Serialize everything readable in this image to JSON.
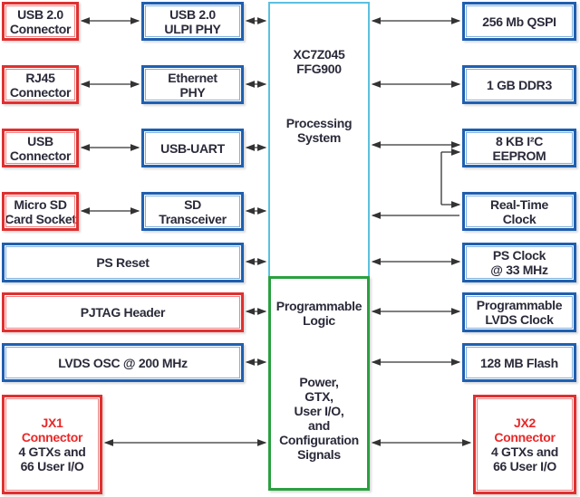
{
  "left_connectors": [
    {
      "l1": "USB 2.0",
      "l2": "Connector"
    },
    {
      "l1": "RJ45",
      "l2": "Connector"
    },
    {
      "l1": "USB",
      "l2": "Connector"
    },
    {
      "l1": "Micro SD",
      "l2": "Card Socket"
    }
  ],
  "left_phys": [
    {
      "l1": "USB 2.0",
      "l2": "ULPI PHY"
    },
    {
      "l1": "Ethernet",
      "l2": "PHY"
    },
    {
      "l1": "USB-UART",
      "l2": ""
    },
    {
      "l1": "SD",
      "l2": "Transceiver"
    }
  ],
  "ps_reset": "PS Reset",
  "pjtag": "PJTAG Header",
  "lvds_osc": "LVDS OSC @ 200 MHz",
  "jx1": {
    "title1": "JX1",
    "title2": "Connector",
    "l1": "4 GTXs and",
    "l2": "66 User I/O"
  },
  "jx2": {
    "title1": "JX2",
    "title2": "Connector",
    "l1": "4 GTXs and",
    "l2": "66 User I/O"
  },
  "center": {
    "chip1": "XC7Z045",
    "chip2": "FFG900",
    "ps1": "Processing",
    "ps2": "System",
    "pl1": "Programmable",
    "pl2": "Logic",
    "sig": [
      "Power,",
      "GTX,",
      "User I/O,",
      "and",
      "Configuration",
      "Signals"
    ]
  },
  "right": [
    {
      "l1": "256 Mb QSPI",
      "l2": ""
    },
    {
      "l1": "1 GB DDR3",
      "l2": ""
    },
    {
      "l1": "8 KB I²C",
      "l2": "EEPROM"
    },
    {
      "l1": "Real-Time",
      "l2": "Clock"
    },
    {
      "l1": "PS Clock",
      "l2": "@ 33 MHz"
    },
    {
      "l1": "Programmable",
      "l2": "LVDS Clock"
    },
    {
      "l1": "128 MB Flash",
      "l2": ""
    }
  ],
  "colors": {
    "red": "#e03030",
    "blue": "#1f5fb0",
    "ps_border": "#5bc0e0",
    "pl_border": "#2aa040"
  }
}
